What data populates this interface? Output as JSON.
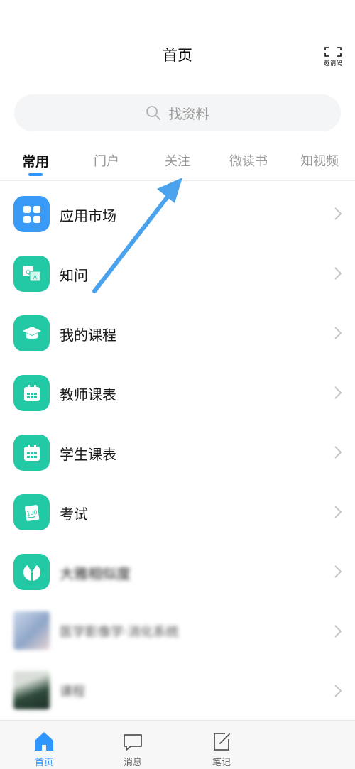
{
  "header": {
    "title": "首页",
    "invite_label": "邀请码"
  },
  "search": {
    "placeholder": "找资料"
  },
  "tabs": [
    {
      "label": "常用",
      "active": true
    },
    {
      "label": "门户",
      "active": false
    },
    {
      "label": "关注",
      "active": false
    },
    {
      "label": "微读书",
      "active": false
    },
    {
      "label": "知视频",
      "active": false
    }
  ],
  "list": [
    {
      "label": "应用市场",
      "icon": "grid-icon",
      "color": "#3a9bf7"
    },
    {
      "label": "知问",
      "icon": "qa-icon",
      "color": "#22c9a4"
    },
    {
      "label": "我的课程",
      "icon": "graduation-cap-icon",
      "color": "#22c9a4"
    },
    {
      "label": "教师课表",
      "icon": "calendar-icon",
      "color": "#22c9a4"
    },
    {
      "label": "学生课表",
      "icon": "calendar-icon",
      "color": "#22c9a4"
    },
    {
      "label": "考试",
      "icon": "exam-paper-icon",
      "color": "#22c9a4"
    },
    {
      "label": "大雅相似度",
      "icon": "pie-icon",
      "color": "#22c9a4"
    },
    {
      "label": "医学影像学·消化系统",
      "icon": "course-thumbnail",
      "color": "#8fa6c8"
    },
    {
      "label": "课程",
      "icon": "course-thumbnail",
      "color": "#2d4a3a"
    }
  ],
  "bottom_nav": [
    {
      "label": "首页",
      "icon": "home-icon",
      "active": true
    },
    {
      "label": "消息",
      "icon": "chat-icon",
      "active": false
    },
    {
      "label": "笔记",
      "icon": "note-icon",
      "active": false
    }
  ],
  "colors": {
    "accent": "#2f96ff",
    "teal": "#22c9a4",
    "annotation_arrow": "#4aa3ec"
  }
}
